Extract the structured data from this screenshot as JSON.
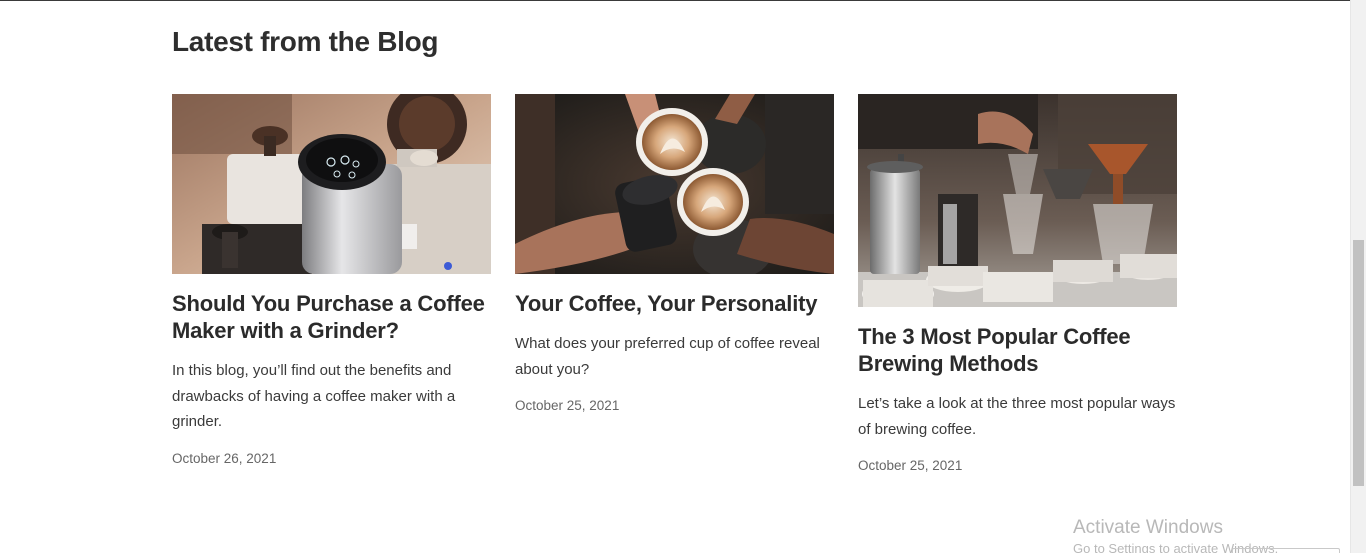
{
  "section": {
    "title": "Latest from the Blog"
  },
  "posts": [
    {
      "image_alt": "coffee-grinder-photo",
      "title": "Should You Purchase a Coffee Maker with a Grinder?",
      "excerpt": "In this blog, you’ll find out the benefits and drawbacks of having a coffee maker with a grinder.",
      "date": "October 26, 2021"
    },
    {
      "image_alt": "coffee-cups-toast-photo",
      "title": "Your Coffee, Your Personality",
      "excerpt": "What does your preferred cup of coffee reveal about you?",
      "date": "October 25, 2021"
    },
    {
      "image_alt": "coffee-brewing-equipment-photo",
      "title": "The 3 Most Popular Coffee Brewing Methods",
      "excerpt": "Let’s take a look at the three most popular ways of brewing coffee.",
      "date": "October 25, 2021"
    }
  ],
  "watermark": {
    "title": "Activate Windows",
    "subtitle": "Go to Settings to activate Windows."
  },
  "colors": {
    "heading": "#2e2e2e",
    "body": "#3a3a3a",
    "date": "#666666",
    "watermark": "#b8b8b8"
  }
}
